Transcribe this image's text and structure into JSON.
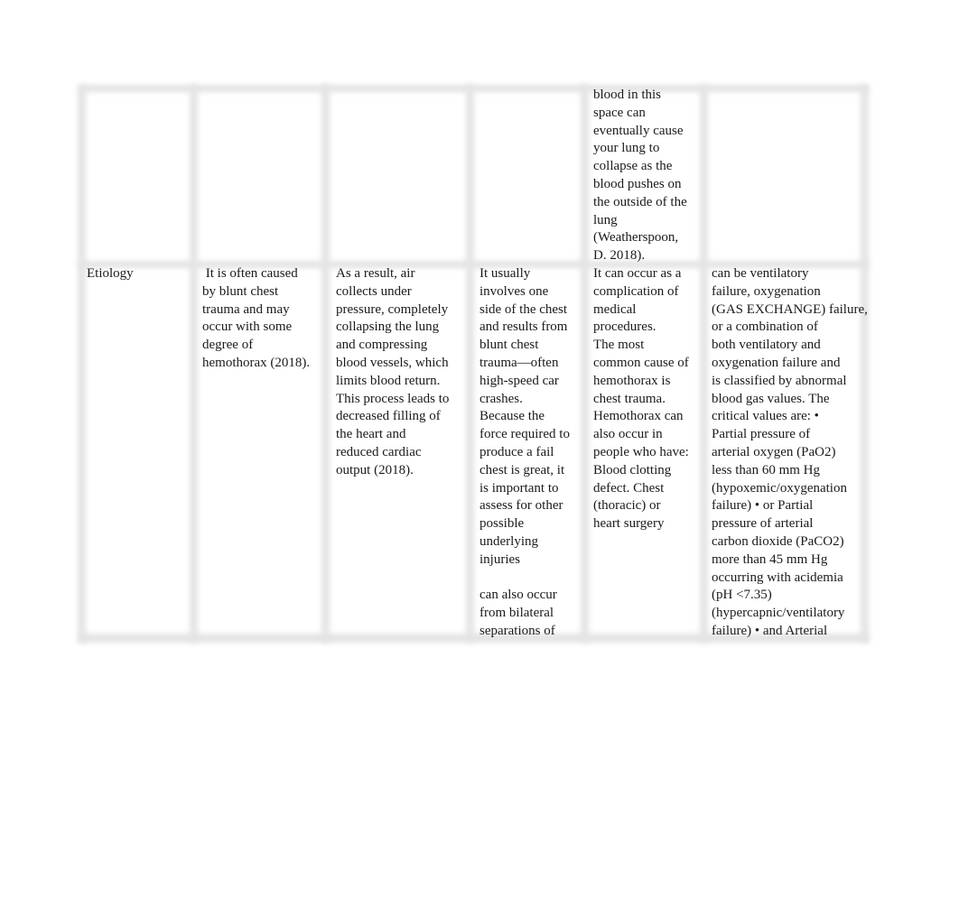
{
  "document": {
    "table": {
      "rows": [
        {
          "label": "",
          "cells": [
            "",
            "",
            "",
            "blood in this\nspace can\neventually cause\nyour lung to\ncollapse as the\nblood pushes on\nthe outside of the\nlung\n(Weatherspoon,\nD. 2018).",
            ""
          ]
        },
        {
          "label": "Etiology",
          "cells": [
            " It is often caused\nby blunt chest\ntrauma and may\noccur with some\ndegree of\nhemothorax (2018).",
            "As a result, air\ncollects under\npressure, completely\ncollapsing the lung\nand compressing\nblood vessels, which\nlimits blood return.\nThis process leads to\ndecreased filling of\nthe heart and\nreduced cardiac\noutput (2018).",
            "It usually\ninvolves one\nside of the chest\nand results from\nblunt chest\ntrauma—often\nhigh-speed car\ncrashes.\nBecause the\nforce required to\nproduce a fail\nchest is great, it\nis important to\nassess for other\npossible\nunderlying\ninjuries\n\ncan also occur\nfrom bilateral\nseparations of",
            "It can occur as a\ncomplication of\nmedical\nprocedures.\nThe most\ncommon cause of\nhemothorax is\nchest trauma.\nHemothorax can\nalso occur in\npeople who have:\nBlood clotting\ndefect. Chest\n(thoracic) or\nheart surgery",
            "can be ventilatory\nfailure, oxygenation\n(GAS EXCHANGE) failure,\nor a combination of\nboth ventilatory and\noxygenation failure and\nis classified by abnormal\nblood gas values. The\ncritical values are: •\nPartial pressure of\narterial oxygen (PaO2)\nless than 60 mm Hg\n(hypoxemic/oxygenation\nfailure) • or Partial\npressure of arterial\ncarbon dioxide (PaCO2)\nmore than 45 mm Hg\noccurring with acidemia\n(pH <7.35)\n(hypercapnic/ventilatory\nfailure) • and Arterial"
          ]
        }
      ]
    }
  }
}
